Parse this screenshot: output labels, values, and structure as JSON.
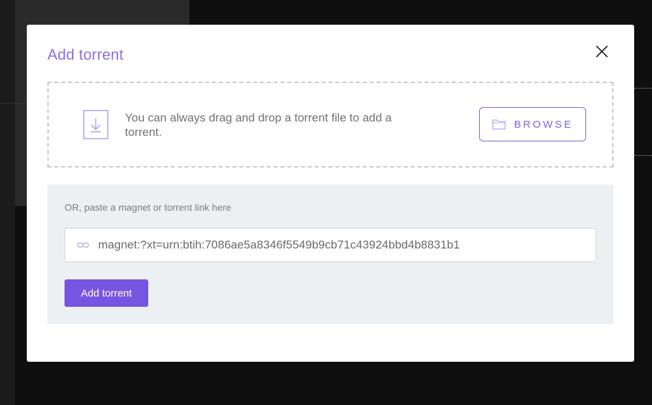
{
  "modal": {
    "title": "Add torrent",
    "close_icon": "close-icon"
  },
  "drop_zone": {
    "icon": "download-icon",
    "text": "You can always drag and drop a torrent file to add a torrent.",
    "browse_label": "BROWSE",
    "browse_icon": "folder-icon"
  },
  "link_panel": {
    "hint": "OR, paste a magnet or torrent link here",
    "input_icon": "link-icon",
    "input_value": "magnet:?xt=urn:btih:7086ae5a8346f5549b9cb71c43924bbd4b8831b1",
    "submit_label": "Add torrent"
  },
  "colors": {
    "accent": "#7855e0",
    "title": "#8b6fe0",
    "panel_bg": "#edf0f3",
    "backdrop": "#0f0f0f"
  }
}
